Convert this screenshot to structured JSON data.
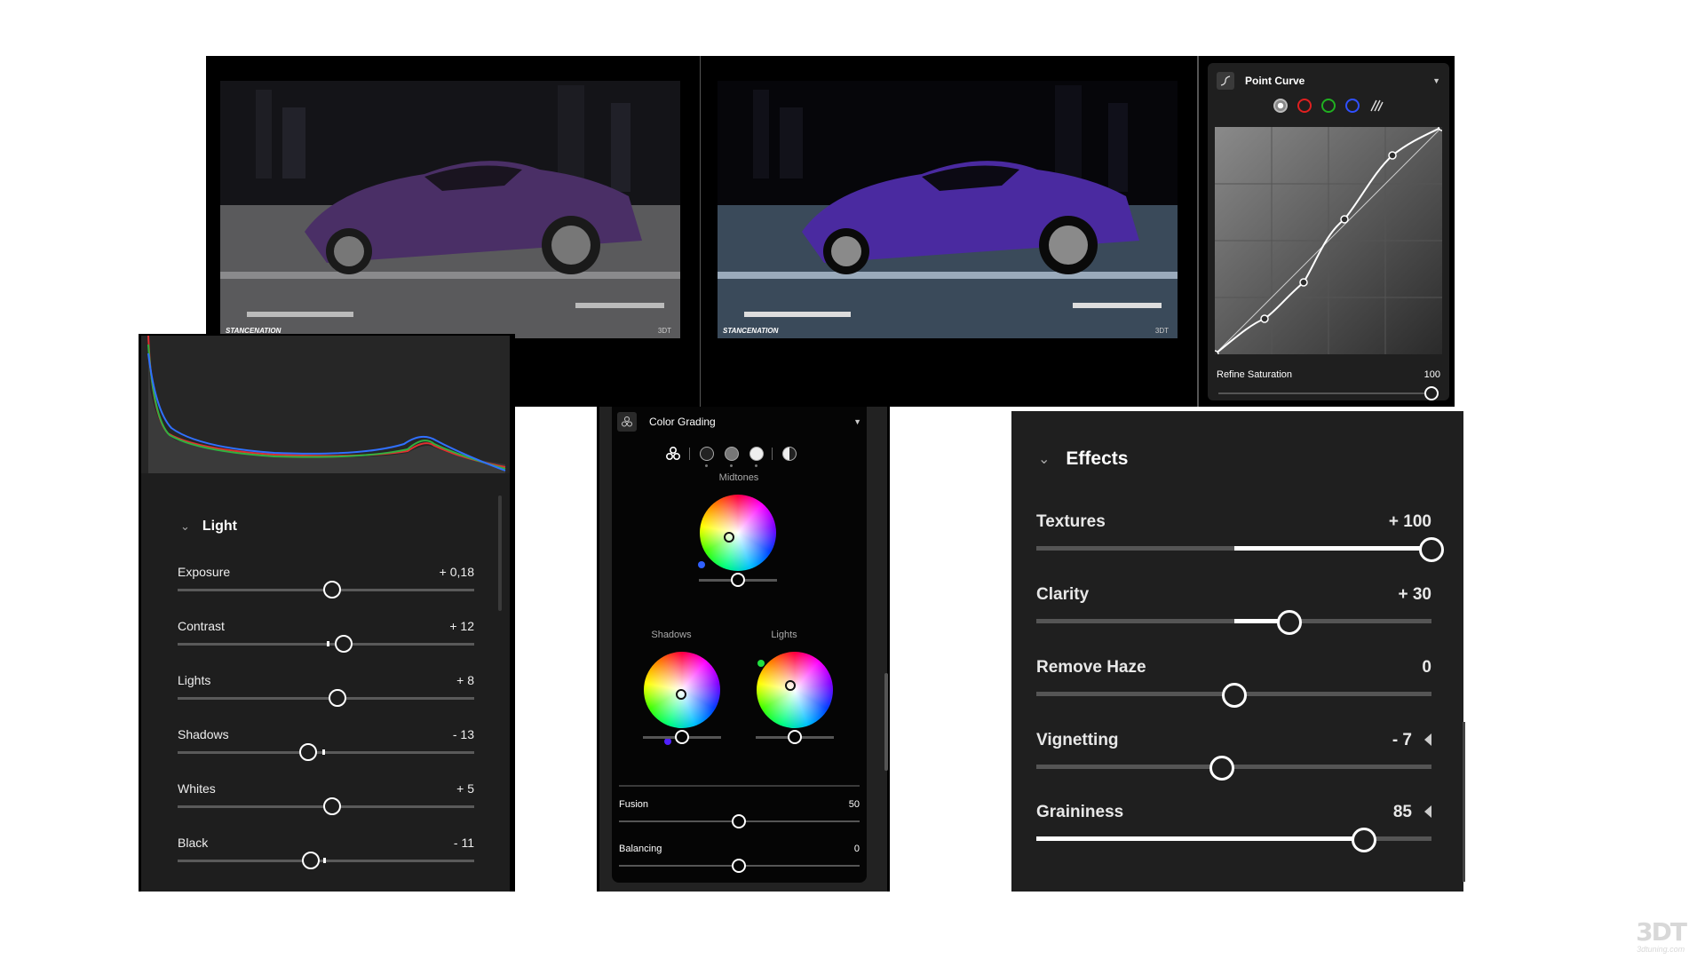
{
  "photos": {
    "before_watermark": "STANCENATION",
    "after_watermark": "STANCENATION",
    "photo_logo": "3DT"
  },
  "point_curve": {
    "title": "Point Curve",
    "channels": [
      {
        "name": "rgb",
        "color": "#bbbbbb"
      },
      {
        "name": "red",
        "color": "#e02020"
      },
      {
        "name": "green",
        "color": "#20b020"
      },
      {
        "name": "blue",
        "color": "#3050ff"
      }
    ],
    "refine_saturation_label": "Refine Saturation",
    "refine_saturation_value": "100",
    "refine_saturation_level": 1.0
  },
  "light": {
    "title": "Light",
    "sliders": [
      {
        "label": "Exposure",
        "value": "+ 0,18",
        "level": 0.52
      },
      {
        "label": "Contrast",
        "value": "+ 12",
        "level": 0.56
      },
      {
        "label": "Lights",
        "value": "+ 8",
        "level": 0.54
      },
      {
        "label": "Shadows",
        "value": "- 13",
        "level": 0.44
      },
      {
        "label": "Whites",
        "value": "+ 5",
        "level": 0.52
      },
      {
        "label": "Black",
        "value": "- 11",
        "level": 0.45
      }
    ]
  },
  "color_grading": {
    "title": "Color Grading",
    "midtones_label": "Midtones",
    "shadows_label": "Shadows",
    "lights_label": "Lights",
    "fusion_label": "Fusion",
    "fusion_value": "50",
    "balancing_label": "Balancing",
    "balancing_value": "0"
  },
  "effects": {
    "title": "Effects",
    "sliders": [
      {
        "label": "Textures",
        "value": "+ 100",
        "level": 1.0,
        "reset": false
      },
      {
        "label": "Clarity",
        "value": "+ 30",
        "level": 0.64,
        "reset": false
      },
      {
        "label": "Remove Haze",
        "value": "0",
        "level": 0.5,
        "reset": false
      },
      {
        "label": "Vignetting",
        "value": "- 7",
        "level": 0.47,
        "reset": true
      },
      {
        "label": "Graininess",
        "value": "85",
        "level": 0.83,
        "reset": true
      }
    ]
  },
  "brand": {
    "logo": "3DT",
    "url": "3dtuning.com"
  }
}
